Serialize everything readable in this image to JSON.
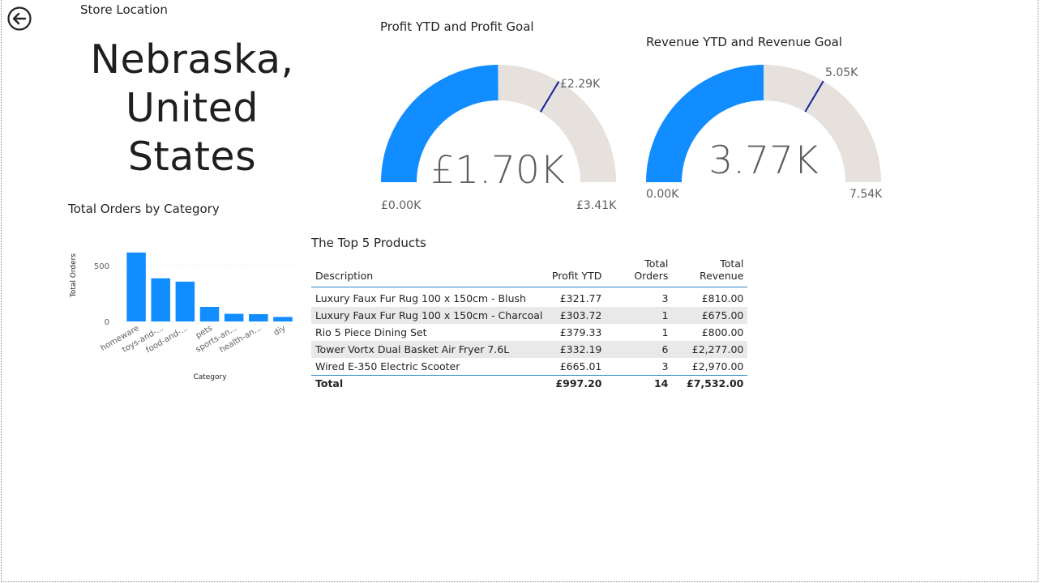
{
  "store": {
    "label": "Store Location",
    "location_line1": "Nebraska,",
    "location_line2": "United",
    "location_line3": "States"
  },
  "profit_gauge": {
    "title": "Profit YTD and Profit Goal",
    "value_label": "£1.70K",
    "min_label": "£0.00K",
    "max_label": "£3.41K",
    "target_label": "£2.29K",
    "value": 1.7,
    "min": 0,
    "max": 3.41,
    "target": 2.29,
    "fill_color": "#118dff",
    "track_color": "#e6e1dc",
    "target_color": "#12239e"
  },
  "revenue_gauge": {
    "title": "Revenue YTD and Revenue Goal",
    "value_label": "3.77K",
    "min_label": "0.00K",
    "max_label": "7.54K",
    "target_label": "5.05K",
    "value": 3.77,
    "min": 0,
    "max": 7.54,
    "target": 5.05,
    "fill_color": "#118dff",
    "track_color": "#e6e1dc",
    "target_color": "#12239e"
  },
  "chart_data": {
    "type": "bar",
    "title": "Total Orders by Category",
    "xlabel": "Category",
    "ylabel": "Total Orders",
    "categories": [
      "homeware",
      "toys-and-...",
      "food-and-...",
      "pets",
      "sports-an...",
      "health-an...",
      "diy"
    ],
    "values": [
      615,
      385,
      355,
      130,
      68,
      65,
      40
    ],
    "yticks": [
      0,
      500
    ],
    "ylim": [
      0,
      650
    ],
    "color": "#118dff"
  },
  "top_products": {
    "title": "The Top 5 Products",
    "columns": [
      "Description",
      "Profit YTD",
      "Total Orders",
      "Total Revenue"
    ],
    "rows": [
      [
        "Luxury Faux Fur Rug 100 x 150cm - Blush",
        "£321.77",
        "3",
        "£810.00"
      ],
      [
        "Luxury Faux Fur Rug 100 x 150cm - Charcoal",
        "£303.72",
        "1",
        "£675.00"
      ],
      [
        "Rio 5 Piece Dining Set",
        "£379.33",
        "1",
        "£800.00"
      ],
      [
        "Tower Vortx Dual Basket Air Fryer 7.6L",
        "£332.19",
        "6",
        "£2,277.00"
      ],
      [
        "Wired E-350 Electric Scooter",
        "£665.01",
        "3",
        "£2,970.00"
      ]
    ],
    "total": [
      "Total",
      "£997.20",
      "14",
      "£7,532.00"
    ]
  },
  "icons": {
    "back": "back-arrow-icon"
  }
}
